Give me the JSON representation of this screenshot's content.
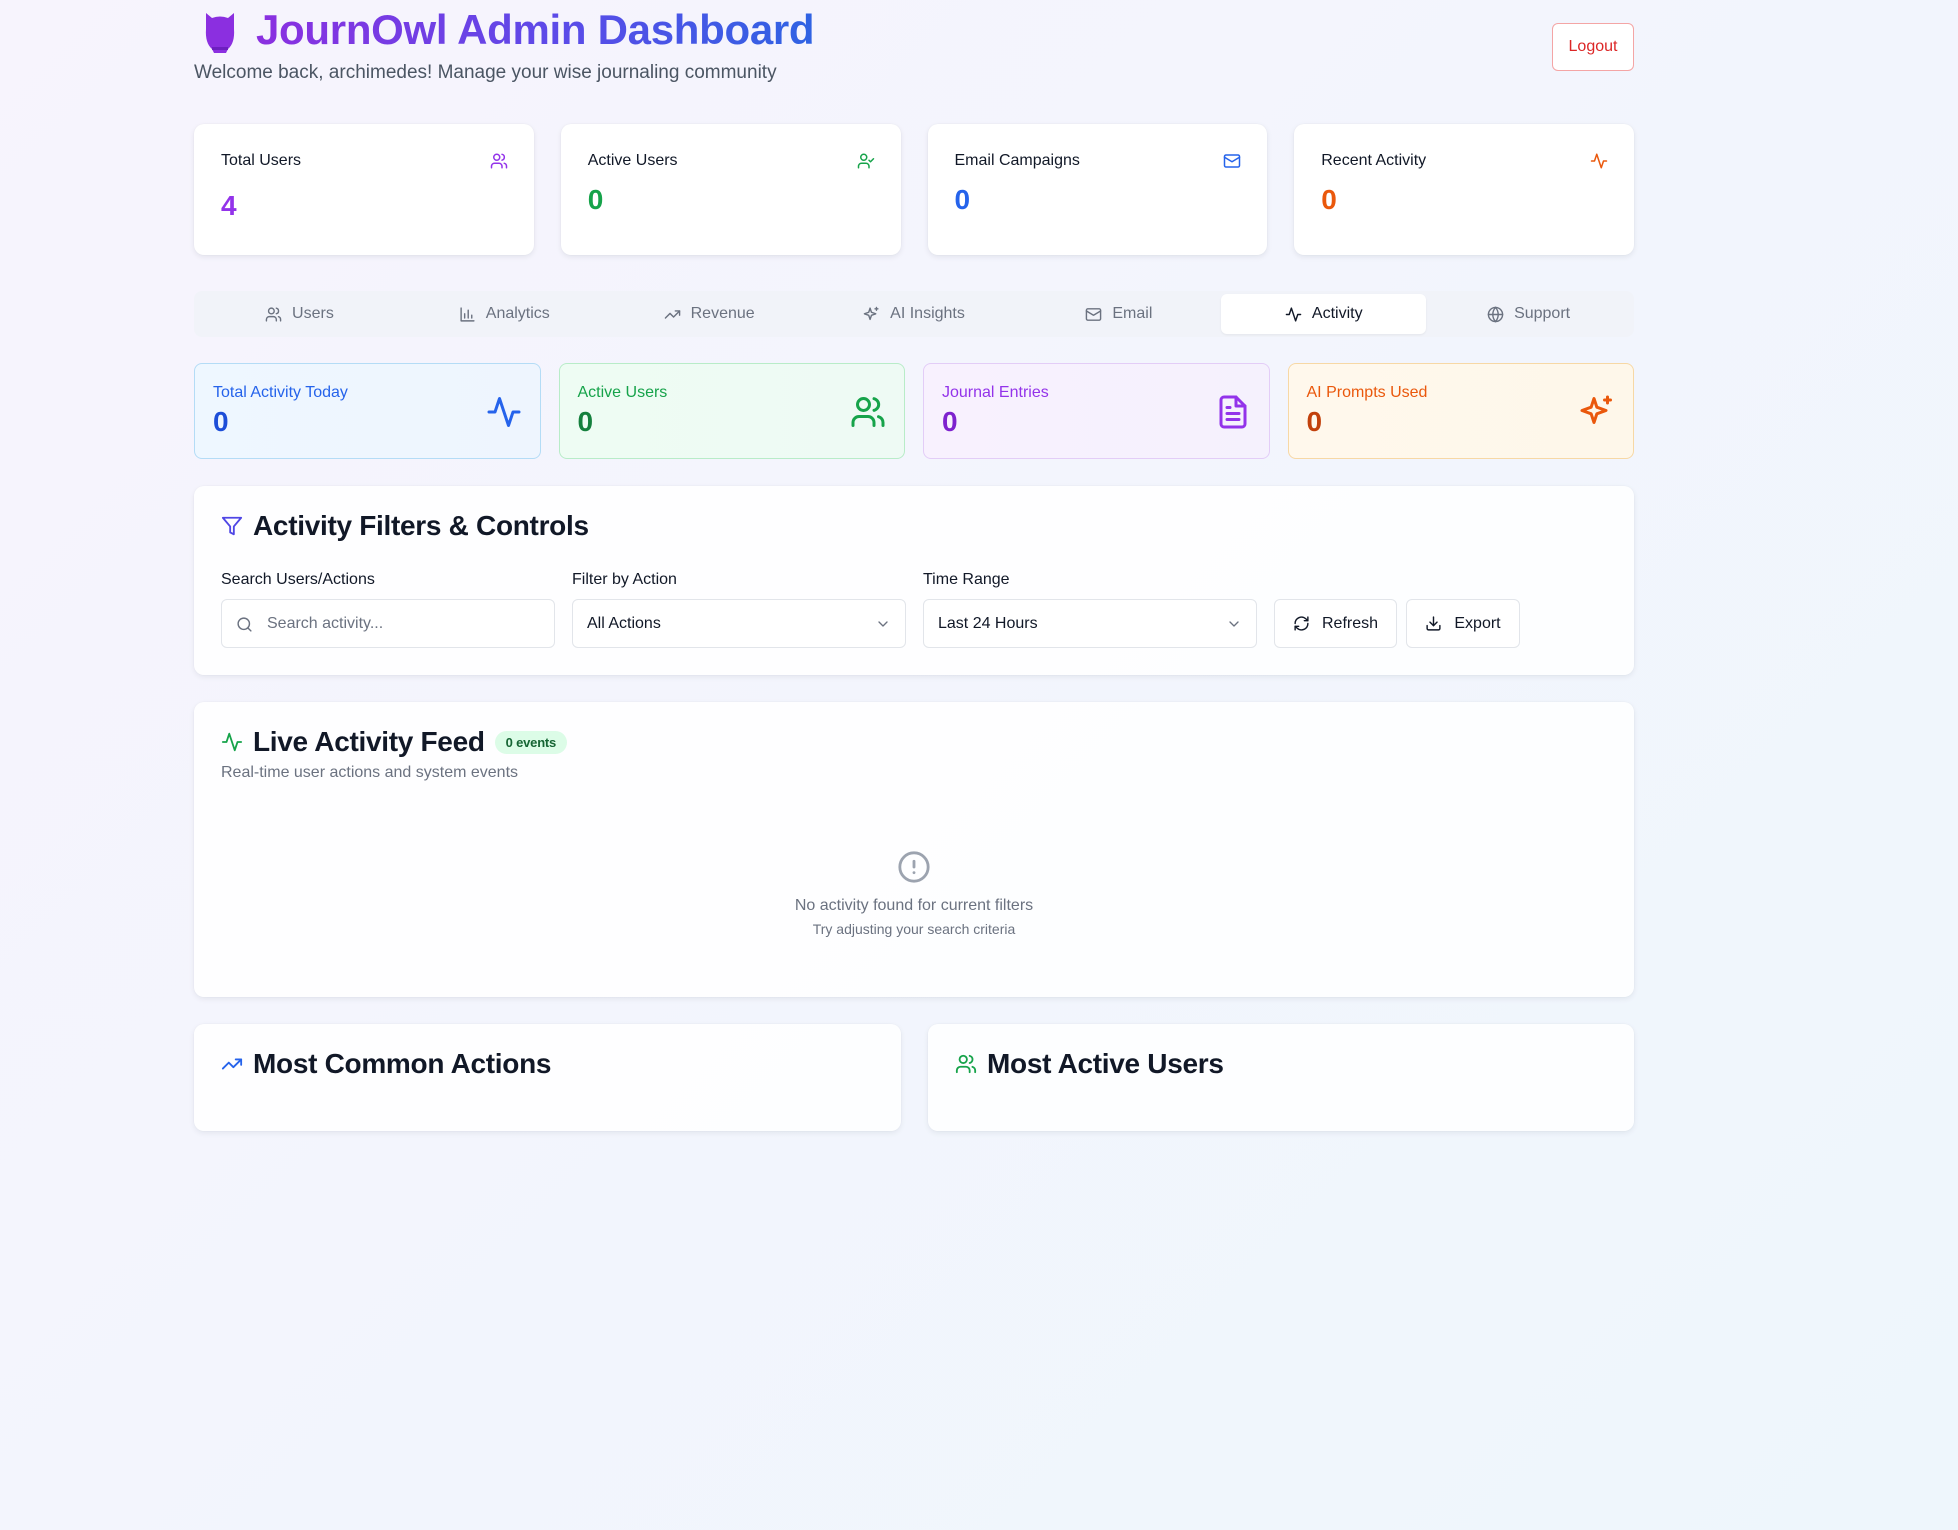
{
  "header": {
    "title": "JournOwl Admin Dashboard",
    "subtitle": "Welcome back, archimedes! Manage your wise journaling community",
    "logout_label": "Logout"
  },
  "stats": [
    {
      "label": "Total Users",
      "value": "4",
      "icon": "users-icon",
      "color": "#9333ea"
    },
    {
      "label": "Active Users",
      "value": "0",
      "icon": "user-check-icon",
      "color": "#16a34a"
    },
    {
      "label": "Email Campaigns",
      "value": "0",
      "icon": "mail-icon",
      "color": "#2563eb"
    },
    {
      "label": "Recent Activity",
      "value": "0",
      "icon": "activity-icon",
      "color": "#ea580c"
    }
  ],
  "tabs": [
    {
      "label": "Users",
      "icon": "users-icon",
      "active": false
    },
    {
      "label": "Analytics",
      "icon": "bar-chart-icon",
      "active": false
    },
    {
      "label": "Revenue",
      "icon": "trending-up-icon",
      "active": false
    },
    {
      "label": "AI Insights",
      "icon": "sparkles-icon",
      "active": false
    },
    {
      "label": "Email",
      "icon": "mail-icon",
      "active": false
    },
    {
      "label": "Activity",
      "icon": "activity-icon",
      "active": true
    },
    {
      "label": "Support",
      "icon": "globe-icon",
      "active": false
    }
  ],
  "metrics": [
    {
      "label": "Total Activity Today",
      "value": "0",
      "icon": "activity-icon",
      "color": "#1d4ed8",
      "label_color": "#2563eb"
    },
    {
      "label": "Active Users",
      "value": "0",
      "icon": "users-icon",
      "color": "#15803d",
      "label_color": "#16a34a"
    },
    {
      "label": "Journal Entries",
      "value": "0",
      "icon": "file-text-icon",
      "color": "#7e22ce",
      "label_color": "#9333ea"
    },
    {
      "label": "AI Prompts Used",
      "value": "0",
      "icon": "sparkles-icon",
      "color": "#c2410c",
      "label_color": "#ea580c"
    }
  ],
  "filters": {
    "title": "Activity Filters & Controls",
    "search_label": "Search Users/Actions",
    "search_placeholder": "Search activity...",
    "action_label": "Filter by Action",
    "action_value": "All Actions",
    "time_label": "Time Range",
    "time_value": "Last 24 Hours",
    "refresh_label": "Refresh",
    "export_label": "Export"
  },
  "feed": {
    "title": "Live Activity Feed",
    "badge": "0 events",
    "subtitle": "Real-time user actions and system events",
    "empty_title": "No activity found for current filters",
    "empty_hint": "Try adjusting your search criteria"
  },
  "sections": {
    "common_actions": "Most Common Actions",
    "active_users": "Most Active Users"
  },
  "colors": {
    "accent_purple": "#9333ea",
    "accent_blue": "#2563eb",
    "danger": "#dc2626",
    "success": "#16a34a"
  }
}
